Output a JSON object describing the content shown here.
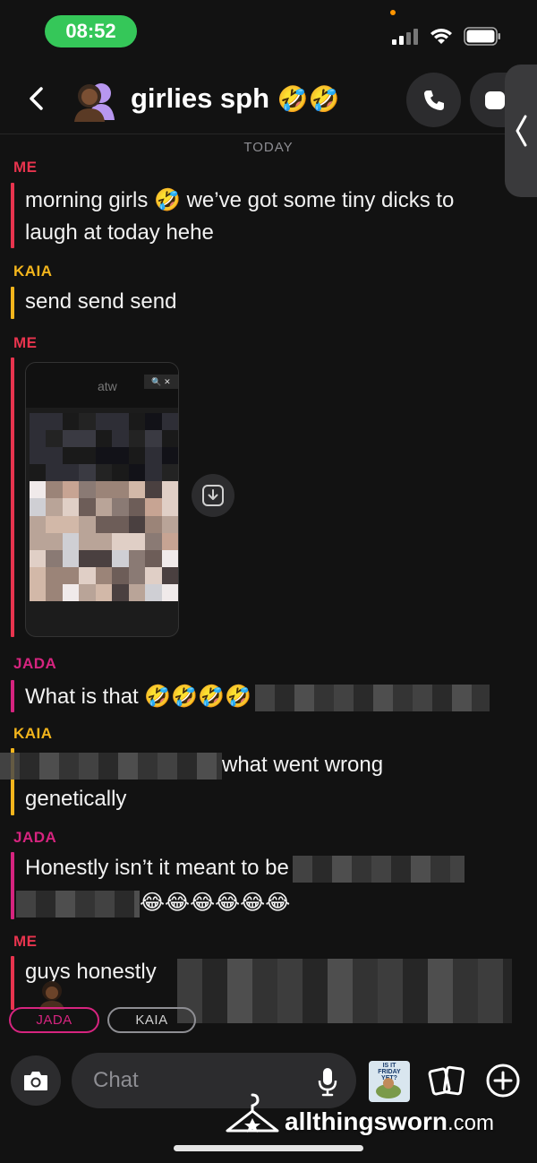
{
  "status_bar": {
    "time": "08:52"
  },
  "header": {
    "title": "girlies sph",
    "title_emoji": "🤣🤣",
    "icons": [
      "back-arrow-icon",
      "group-avatar-icon",
      "phone-icon",
      "video-icon",
      "chevron-left-icon"
    ]
  },
  "date_label": "TODAY",
  "messages": [
    {
      "sender": "ME",
      "lines": [
        "morning girls 🤣 we’ve got some tiny dicks to",
        "laugh at today hehe"
      ]
    },
    {
      "sender": "KAIA",
      "lines": [
        "send send send"
      ]
    },
    {
      "sender": "ME",
      "media": {
        "brand": "atw",
        "type": "image",
        "blurred": true
      }
    },
    {
      "sender": "JADA",
      "lines": [
        "What is that 🤣🤣🤣🤣"
      ]
    },
    {
      "sender": "KAIA",
      "lines": [
        "what went wrong",
        "genetically"
      ]
    },
    {
      "sender": "JADA",
      "lines": [
        "Honestly isn’t it meant to be",
        "😂😂😂😂😂😂"
      ]
    },
    {
      "sender": "ME",
      "lines": [
        "guys honestly"
      ]
    }
  ],
  "reply_chips": [
    "JADA",
    "KAIA"
  ],
  "input": {
    "placeholder": "Chat"
  },
  "watermark": {
    "name": "allthingsworn",
    "domain": ".com"
  },
  "colors": {
    "me": "#e8344e",
    "kaia": "#f3b51c",
    "jada": "#d6247f",
    "status_green": "#35c759",
    "background": "#121212"
  }
}
